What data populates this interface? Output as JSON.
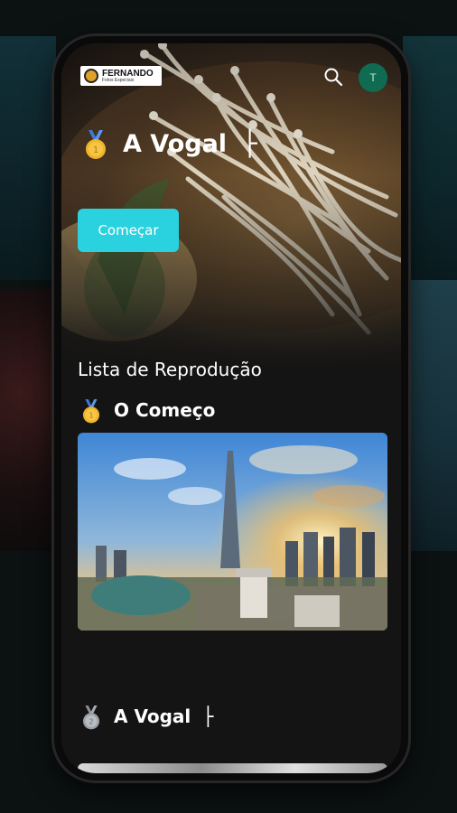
{
  "header": {
    "logo_name": "FERNANDO",
    "logo_subtitle": "Fotos Especiais",
    "avatar_initial": "T"
  },
  "hero": {
    "title": "A Vogal",
    "title_mark": "├",
    "cta_label": "Começar"
  },
  "playlist": {
    "heading": "Lista de Reprodução",
    "sections": [
      {
        "title": "O Começo",
        "medal": "gold"
      },
      {
        "title": "A Vogal",
        "title_mark": "├",
        "medal": "silver"
      }
    ]
  },
  "icons": {
    "search": "search-icon",
    "medal_gold": "gold-medal-icon",
    "medal_silver": "silver-medal-icon"
  },
  "colors": {
    "accent": "#2ad2e0",
    "background": "#141414",
    "avatar_bg": "#0f6b52",
    "medal_gold": "#f0b429",
    "medal_ribbon": "#3b7bd6"
  }
}
